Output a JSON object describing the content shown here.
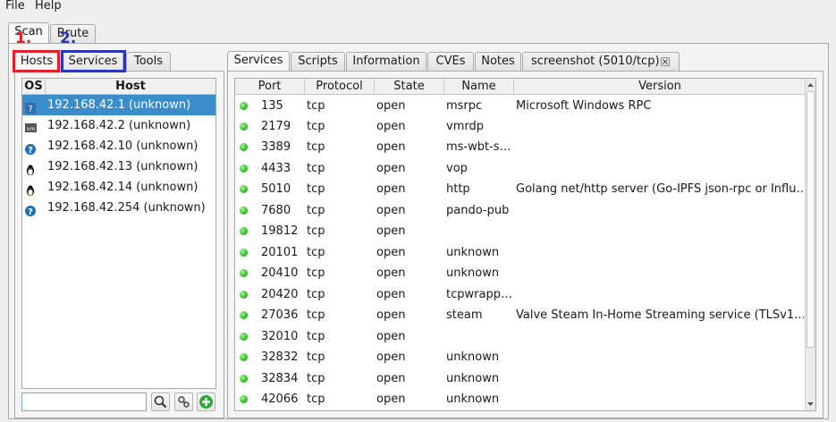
{
  "menu": {
    "file": "File",
    "help": "Help"
  },
  "top_tabs": [
    {
      "label": "Scan"
    },
    {
      "label": "Brute"
    }
  ],
  "left_tabs": [
    {
      "label": "Hosts"
    },
    {
      "label": "Services"
    },
    {
      "label": "Tools"
    }
  ],
  "annotations": {
    "one": "1.",
    "two": "2.",
    "one_color": "#e0202a",
    "two_color": "#2a36b8"
  },
  "hosts": {
    "columns": {
      "os": "OS",
      "host": "Host"
    },
    "rows": [
      {
        "os_icon": "unknown-os-icon",
        "host": "192.168.42.1 (unknown)"
      },
      {
        "os_icon": "vm-icon",
        "host": "192.168.42.2 (unknown)"
      },
      {
        "os_icon": "question-icon",
        "host": "192.168.42.10 (unknown)"
      },
      {
        "os_icon": "linux-icon",
        "host": "192.168.42.13 (unknown)"
      },
      {
        "os_icon": "linux-icon",
        "host": "192.168.42.14 (unknown)"
      },
      {
        "os_icon": "question-icon",
        "host": "192.168.42.254 (unknown)"
      }
    ]
  },
  "right_tabs": [
    {
      "label": "Services"
    },
    {
      "label": "Scripts"
    },
    {
      "label": "Information"
    },
    {
      "label": "CVEs"
    },
    {
      "label": "Notes"
    },
    {
      "label": "screenshot (5010/tcp)"
    }
  ],
  "services": {
    "columns": {
      "port": "Port",
      "protocol": "Protocol",
      "state": "State",
      "name": "Name",
      "version": "Version"
    },
    "rows": [
      {
        "port": "135",
        "protocol": "tcp",
        "state": "open",
        "name": "msrpc",
        "version": "Microsoft Windows RPC"
      },
      {
        "port": "2179",
        "protocol": "tcp",
        "state": "open",
        "name": "vmrdp",
        "version": ""
      },
      {
        "port": "3389",
        "protocol": "tcp",
        "state": "open",
        "name": "ms-wbt-s…",
        "version": ""
      },
      {
        "port": "4433",
        "protocol": "tcp",
        "state": "open",
        "name": "vop",
        "version": ""
      },
      {
        "port": "5010",
        "protocol": "tcp",
        "state": "open",
        "name": "http",
        "version": "Golang net/http server (Go-IPFS json-rpc or Influ…"
      },
      {
        "port": "7680",
        "protocol": "tcp",
        "state": "open",
        "name": "pando-pub",
        "version": ""
      },
      {
        "port": "19812",
        "protocol": "tcp",
        "state": "open",
        "name": "",
        "version": ""
      },
      {
        "port": "20101",
        "protocol": "tcp",
        "state": "open",
        "name": "unknown",
        "version": ""
      },
      {
        "port": "20410",
        "protocol": "tcp",
        "state": "open",
        "name": "unknown",
        "version": ""
      },
      {
        "port": "20420",
        "protocol": "tcp",
        "state": "open",
        "name": "tcpwrapp…",
        "version": ""
      },
      {
        "port": "27036",
        "protocol": "tcp",
        "state": "open",
        "name": "steam",
        "version": "Valve Steam In-Home Streaming service (TLSv1.…"
      },
      {
        "port": "32010",
        "protocol": "tcp",
        "state": "open",
        "name": "",
        "version": ""
      },
      {
        "port": "32832",
        "protocol": "tcp",
        "state": "open",
        "name": "unknown",
        "version": ""
      },
      {
        "port": "32834",
        "protocol": "tcp",
        "state": "open",
        "name": "unknown",
        "version": ""
      },
      {
        "port": "42066",
        "protocol": "tcp",
        "state": "open",
        "name": "unknown",
        "version": ""
      }
    ]
  },
  "colors": {
    "selection": "#3a8ccb",
    "status_open": "#2ec21f",
    "add_button": "#2eaa3a"
  }
}
